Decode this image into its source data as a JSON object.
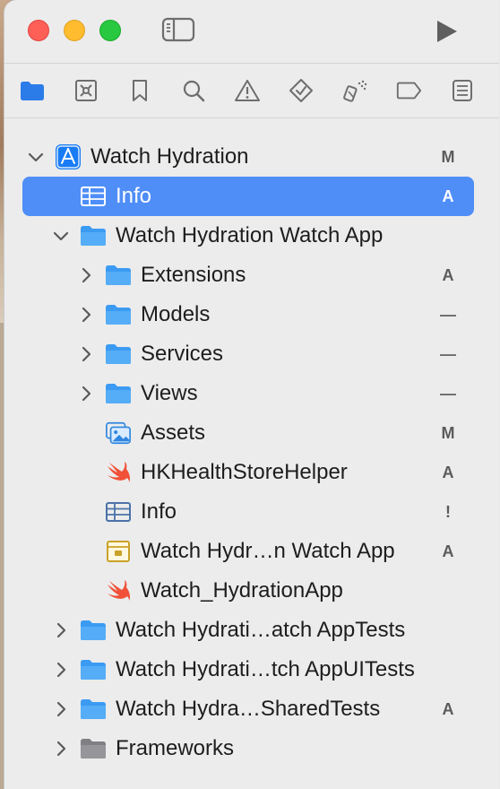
{
  "toolbar": {
    "window_controls": [
      "close",
      "minimize",
      "zoom"
    ],
    "sidebar_toggle_icon": "sidebar-icon",
    "run_icon": "play-icon"
  },
  "navigator_tabs": [
    {
      "icon": "folder-icon",
      "selected": true
    },
    {
      "icon": "source-control-icon"
    },
    {
      "icon": "bookmark-icon"
    },
    {
      "icon": "magnifier-icon"
    },
    {
      "icon": "warning-icon"
    },
    {
      "icon": "test-diamond-icon"
    },
    {
      "icon": "debug-spray-icon"
    },
    {
      "icon": "breakpoint-tag-icon"
    },
    {
      "icon": "report-list-icon"
    }
  ],
  "tree": [
    {
      "label": "Watch Hydration",
      "status": "M",
      "kind": "project",
      "indent": 0,
      "chevron": "down"
    },
    {
      "label": "Info",
      "status": "A",
      "kind": "plist",
      "indent": 1,
      "chevron": "none",
      "selected": true
    },
    {
      "label": "Watch Hydration Watch App",
      "status": "",
      "kind": "folder",
      "indent": 1,
      "chevron": "down"
    },
    {
      "label": "Extensions",
      "status": "A",
      "kind": "folder",
      "indent": 2,
      "chevron": "right"
    },
    {
      "label": "Models",
      "status": "—",
      "kind": "folder",
      "indent": 2,
      "chevron": "right"
    },
    {
      "label": "Services",
      "status": "—",
      "kind": "folder",
      "indent": 2,
      "chevron": "right"
    },
    {
      "label": "Views",
      "status": "—",
      "kind": "folder",
      "indent": 2,
      "chevron": "right"
    },
    {
      "label": "Assets",
      "status": "M",
      "kind": "assets",
      "indent": 2,
      "chevron": "none"
    },
    {
      "label": "HKHealthStoreHelper",
      "status": "A",
      "kind": "swift",
      "indent": 2,
      "chevron": "none"
    },
    {
      "label": "Info",
      "status": "!",
      "kind": "plist",
      "indent": 2,
      "chevron": "none"
    },
    {
      "label": "Watch Hydr…n Watch App",
      "status": "A",
      "kind": "entitlements",
      "indent": 2,
      "chevron": "none"
    },
    {
      "label": "Watch_HydrationApp",
      "status": "",
      "kind": "swift",
      "indent": 2,
      "chevron": "none"
    },
    {
      "label": "Watch Hydrati…atch AppTests",
      "status": "",
      "kind": "folder",
      "indent": 1,
      "chevron": "right"
    },
    {
      "label": "Watch Hydrati…tch AppUITests",
      "status": "",
      "kind": "folder",
      "indent": 1,
      "chevron": "right"
    },
    {
      "label": "Watch Hydra…SharedTests",
      "status": "A",
      "kind": "folder",
      "indent": 1,
      "chevron": "right"
    },
    {
      "label": "Frameworks",
      "status": "",
      "kind": "grayfolder",
      "indent": 1,
      "chevron": "right"
    }
  ],
  "colors": {
    "selection": "#4f8ef7",
    "folder": "#3b9bf3",
    "swift": "#f05138",
    "window_bg": "#ececec"
  }
}
